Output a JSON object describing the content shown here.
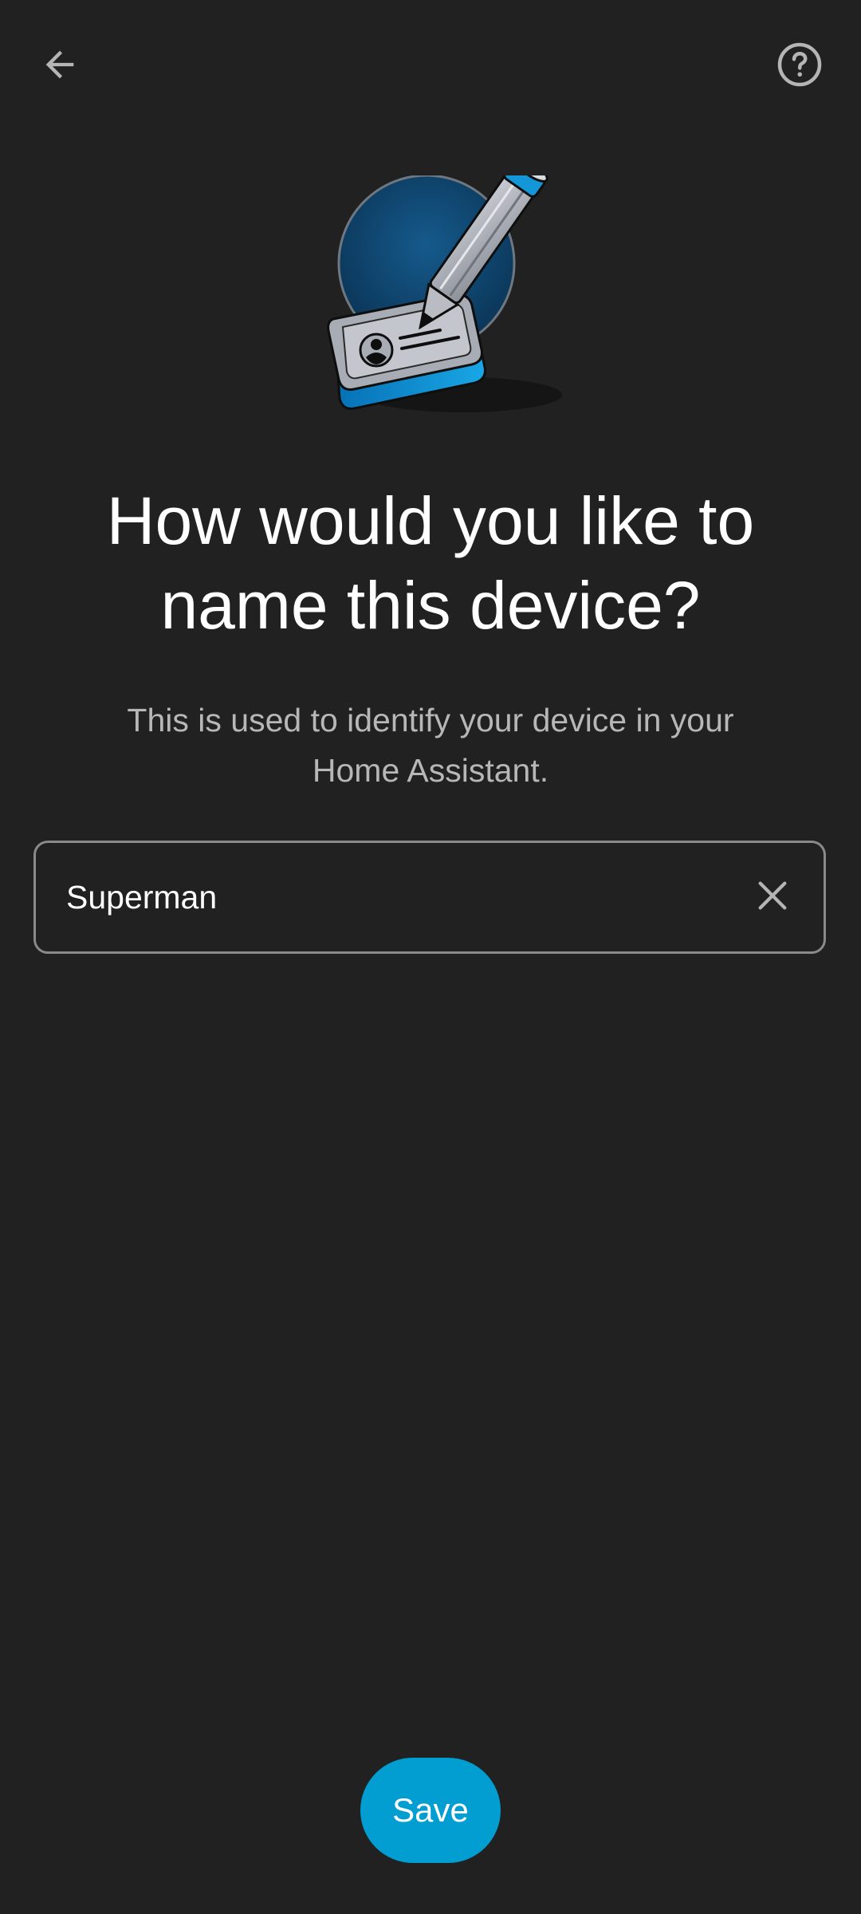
{
  "header": {
    "back_icon": "arrow-left-icon",
    "help_icon": "help-circle-icon"
  },
  "illustration": {
    "icon": "id-card-pencil-illustration",
    "accent_color": "#0a86c7"
  },
  "content": {
    "title": "How would you like to name this device?",
    "subtitle": "This is used to identify your device in your Home Assistant."
  },
  "device_name_field": {
    "value": "Superman",
    "clear_icon": "close-icon"
  },
  "actions": {
    "save_label": "Save",
    "save_color": "#029dd1"
  }
}
